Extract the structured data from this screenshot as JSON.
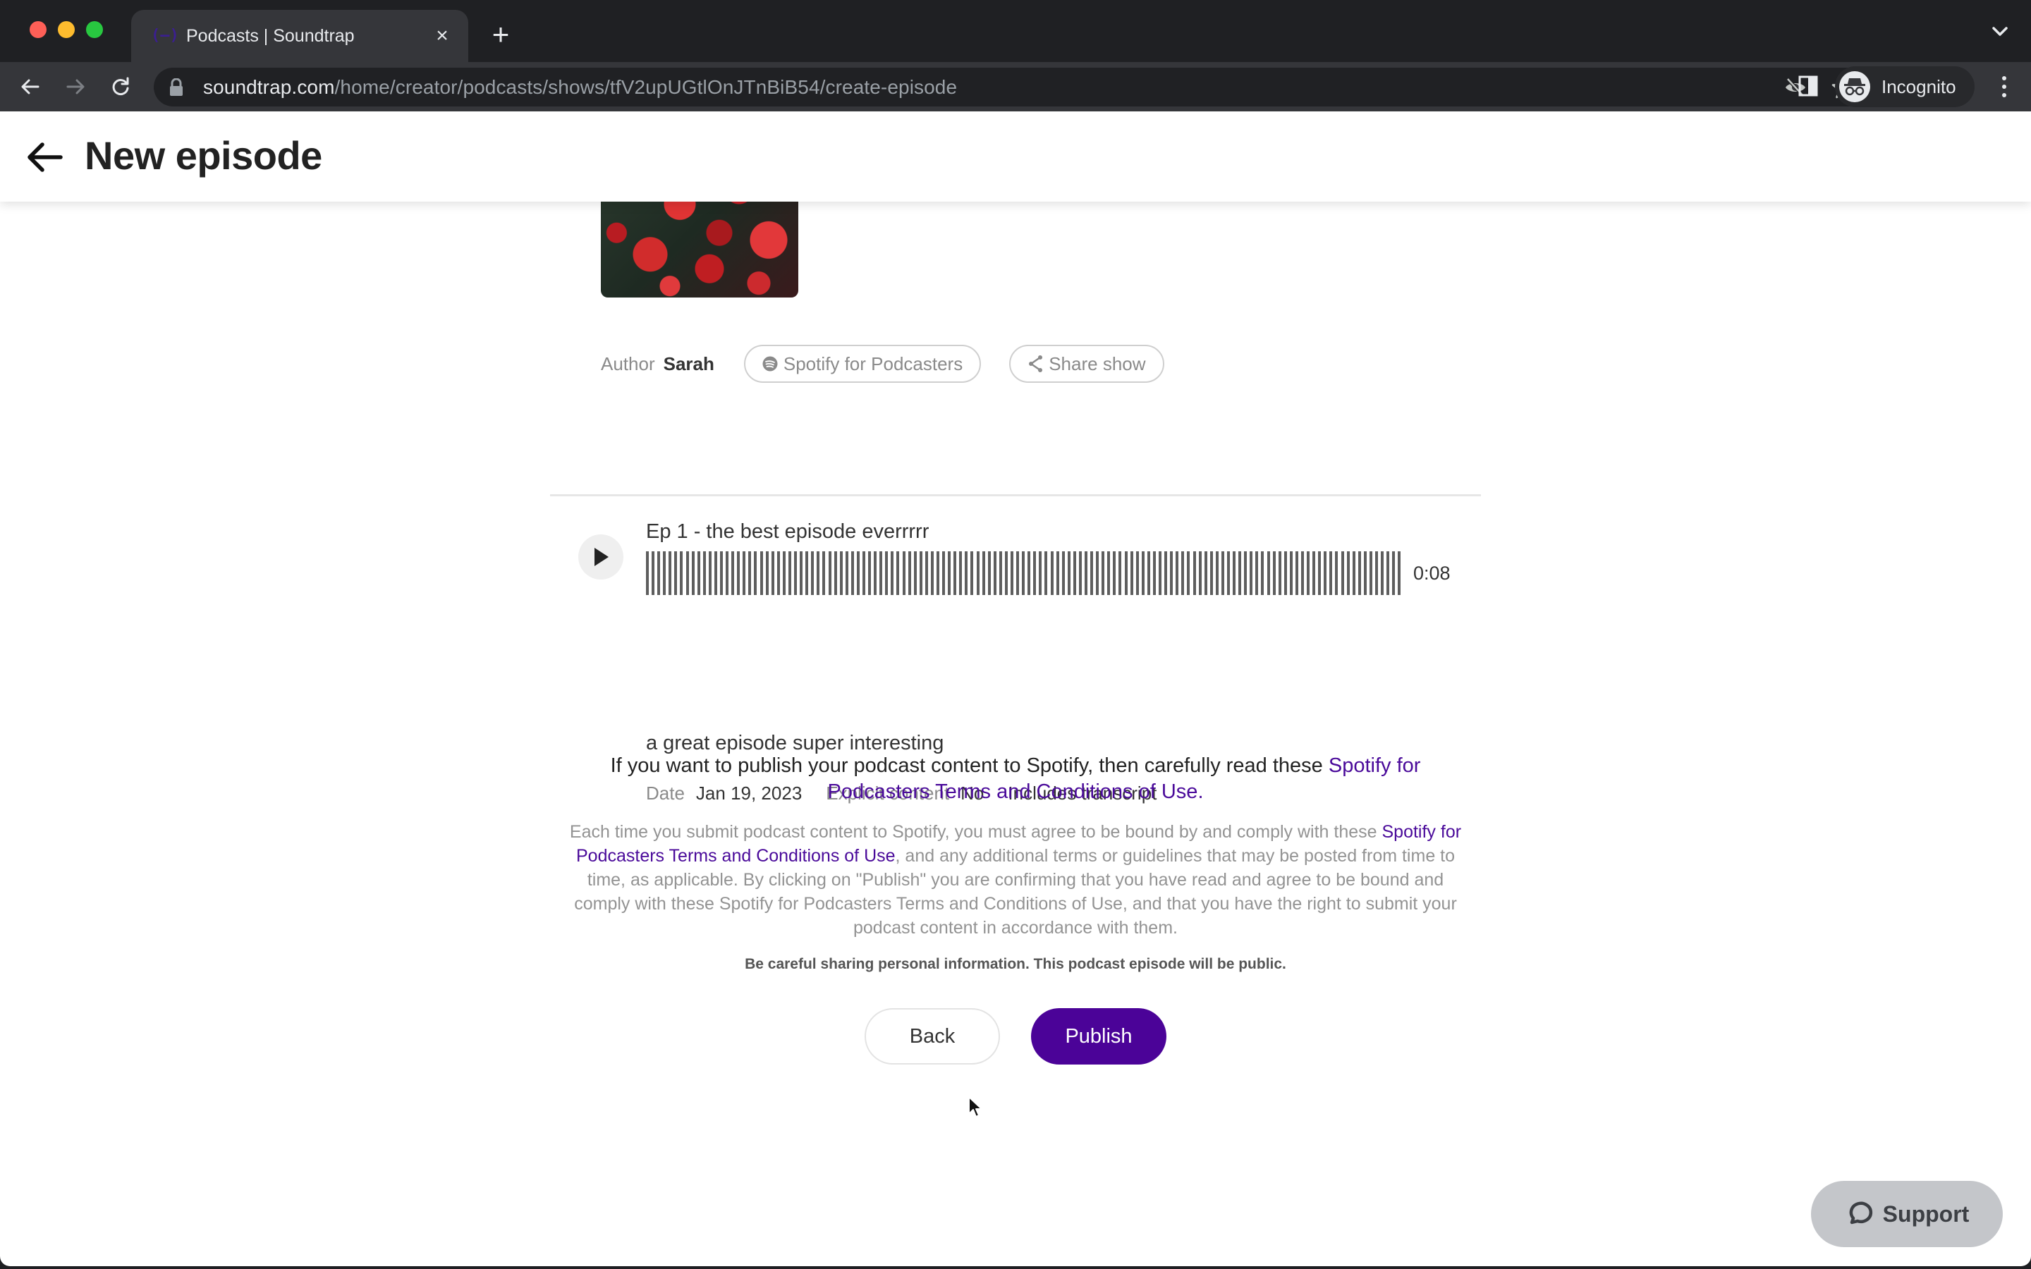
{
  "browser": {
    "tab": {
      "title": "Podcasts | Soundtrap",
      "favicon": "soundtrap-logo-icon"
    },
    "url": {
      "host": "soundtrap.com",
      "path": "/home/creator/podcasts/shows/tfV2upUGtlOnJTnBiB54/create-episode"
    },
    "profile_label": "Incognito",
    "icons": [
      "back-icon",
      "forward-icon",
      "reload-icon",
      "lock-icon",
      "eye-off-icon",
      "star-icon",
      "side-panel-icon",
      "incognito-icon",
      "more-vert-icon",
      "tab-search-chevron-icon",
      "new-tab-plus-icon",
      "tab-close-icon"
    ]
  },
  "header": {
    "title": "New episode"
  },
  "show": {
    "author_label": "Author",
    "author_name": "Sarah",
    "spotify_pill": "Spotify for Podcasters",
    "share_pill": "Share show"
  },
  "episode": {
    "title": "Ep 1 - the best episode everrrrr",
    "duration": "0:08",
    "description": "a great episode super interesting",
    "date_label": "Date",
    "date_value": "Jan 19, 2023",
    "explicit_label": "Explicit content",
    "explicit_value": "No",
    "transcript_label": "Includes transcript"
  },
  "terms": {
    "lead_text": "If you want to publish your podcast content to Spotify, then carefully read these ",
    "lead_link": "Spotify for Podcasters Terms and Conditions of Use",
    "lead_end": ".",
    "body_pre": "Each time you submit podcast content to Spotify, you must agree to be bound by and comply with these ",
    "body_link": "Spotify for Podcasters Terms and Conditions of Use",
    "body_post": ", and any additional terms or guidelines that may be posted from time to time, as applicable. By clicking on \"Publish\" you are confirming that you have read and agree to be bound and comply with these Spotify for Podcasters Terms and Conditions of Use, and that you have the right to submit your podcast content in accordance with them.",
    "warning": "Be careful sharing personal information. This podcast episode will be public."
  },
  "actions": {
    "back_label": "Back",
    "publish_label": "Publish"
  },
  "support": {
    "label": "Support"
  },
  "colors": {
    "accent": "#4b0398",
    "link": "#4a0a9a",
    "support_bg": "#c4c6ca"
  }
}
